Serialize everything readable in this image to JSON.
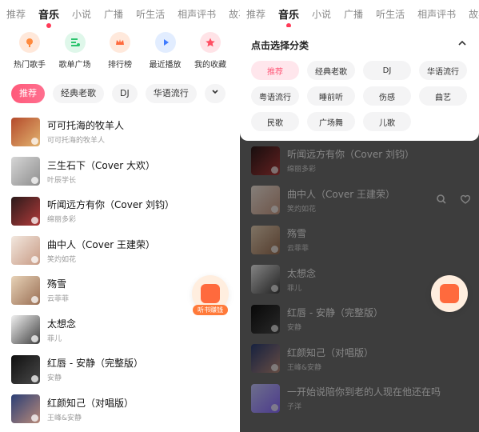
{
  "top_tabs": [
    "推荐",
    "音乐",
    "小说",
    "广播",
    "听生活",
    "相声评书",
    "故事"
  ],
  "active_tab": "音乐",
  "quick_links": [
    {
      "label": "热门歌手",
      "icon": "singer-icon",
      "color": "#ff8a3d"
    },
    {
      "label": "歌单广场",
      "icon": "playlist-icon",
      "color": "#2ac36d"
    },
    {
      "label": "排行榜",
      "icon": "crown-icon",
      "color": "#ff6a3d"
    },
    {
      "label": "最近播放",
      "icon": "play-icon",
      "color": "#3f7bff"
    },
    {
      "label": "我的收藏",
      "icon": "star-icon",
      "color": "#ff4f63"
    }
  ],
  "category_chips": [
    "推荐",
    "经典老歌",
    "DJ",
    "华语流行"
  ],
  "songs_left": [
    {
      "title": "可可托海的牧羊人",
      "subtitle": "可可托海的牧羊人"
    },
    {
      "title": "三生石下（Cover 大欢）",
      "subtitle": "叶辰学长"
    },
    {
      "title": "听闻远方有你（Cover 刘钧）",
      "subtitle": "绵丽多彩"
    },
    {
      "title": "曲中人（Cover 王建荣）",
      "subtitle": "笑灼如花"
    },
    {
      "title": "殇雪",
      "subtitle": "云菲菲"
    },
    {
      "title": "太想念",
      "subtitle": "菲儿"
    },
    {
      "title": "红唇 - 安静（完整版）",
      "subtitle": "安静"
    },
    {
      "title": "红颜知己（对唱版）",
      "subtitle": "王峰&安静"
    }
  ],
  "floating_reward_label": "听书赚钱",
  "dropdown": {
    "title": "点击选择分类",
    "categories": [
      "推荐",
      "经典老歌",
      "DJ",
      "华语流行",
      "粤语流行",
      "睡前听",
      "伤感",
      "曲艺",
      "民歌",
      "广场舞",
      "儿歌"
    ]
  },
  "songs_right": [
    {
      "title": "听闻远方有你（Cover 刘钧）",
      "subtitle": "绵丽多彩"
    },
    {
      "title": "曲中人（Cover 王建荣）",
      "subtitle": "笑灼如花"
    },
    {
      "title": "殇雪",
      "subtitle": "云菲菲"
    },
    {
      "title": "太想念",
      "subtitle": "菲儿"
    },
    {
      "title": "红唇 - 安静（完整版）",
      "subtitle": "安静"
    },
    {
      "title": "红颜知己（对唱版）",
      "subtitle": "王峰&安静"
    },
    {
      "title": "一开始说陪你到老的人现在他还在吗",
      "subtitle": "子洋"
    }
  ]
}
